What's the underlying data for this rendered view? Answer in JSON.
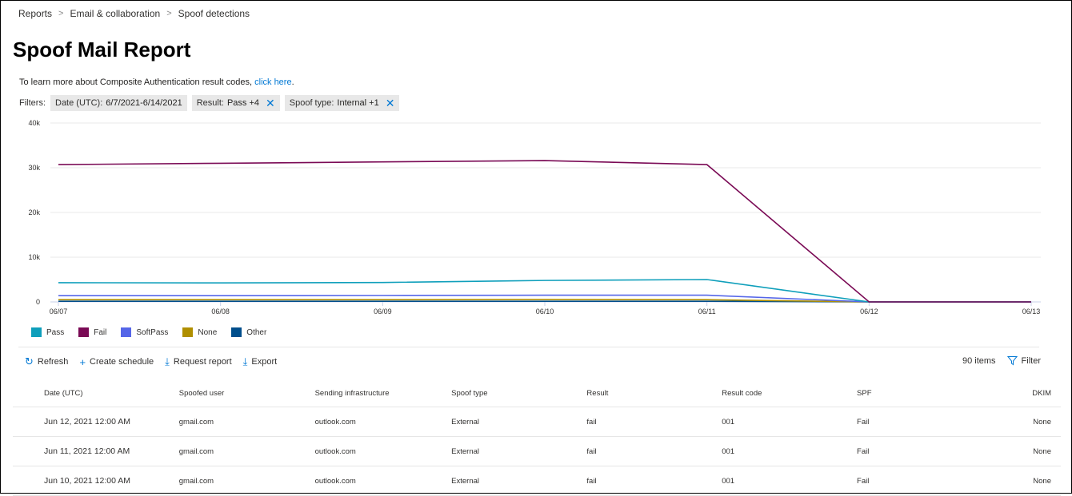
{
  "breadcrumb": [
    "Reports",
    "Email & collaboration",
    "Spoof detections"
  ],
  "title": "Spoof Mail Report",
  "learn": {
    "text": "To learn more about Composite Authentication result codes, ",
    "link": "click here",
    "suffix": "."
  },
  "filters": {
    "label": "Filters:",
    "chips": [
      {
        "key": "Date (UTC):",
        "value": "6/7/2021-6/14/2021",
        "removable": false
      },
      {
        "key": "Result:",
        "value": "Pass +4",
        "removable": true
      },
      {
        "key": "Spoof type:",
        "value": "Internal +1",
        "removable": true
      }
    ]
  },
  "chart_data": {
    "type": "line",
    "x": [
      "06/07",
      "06/08",
      "06/09",
      "06/10",
      "06/11",
      "06/12",
      "06/13"
    ],
    "yticks": [
      "0",
      "10k",
      "20k",
      "30k",
      "40k"
    ],
    "ylim": [
      0,
      40000
    ],
    "grid": true,
    "legend_position": "bottom-left",
    "series": [
      {
        "name": "Pass",
        "color": "#0f9fbb",
        "values": [
          4300,
          4250,
          4350,
          4800,
          5000,
          0,
          0
        ]
      },
      {
        "name": "Fail",
        "color": "#7a0a55",
        "values": [
          30700,
          31000,
          31300,
          31600,
          30700,
          0,
          0
        ]
      },
      {
        "name": "SoftPass",
        "color": "#5566e8",
        "values": [
          1400,
          1400,
          1450,
          1500,
          1500,
          0,
          0
        ]
      },
      {
        "name": "None",
        "color": "#b08f00",
        "values": [
          500,
          500,
          500,
          550,
          500,
          0,
          0
        ]
      },
      {
        "name": "Other",
        "color": "#004e8c",
        "values": [
          150,
          150,
          150,
          150,
          150,
          0,
          0
        ]
      }
    ]
  },
  "toolbar": {
    "refresh": "Refresh",
    "create_schedule": "Create schedule",
    "request_report": "Request report",
    "export": "Export",
    "item_count": "90 items",
    "filter": "Filter"
  },
  "table": {
    "columns": [
      "Date (UTC)",
      "Spoofed user",
      "Sending infrastructure",
      "Spoof type",
      "Result",
      "Result code",
      "SPF",
      "DKIM"
    ],
    "rows": [
      [
        "Jun 12, 2021 12:00 AM",
        "gmail.com",
        "outlook.com",
        "External",
        "fail",
        "001",
        "Fail",
        "None"
      ],
      [
        "Jun 11, 2021 12:00 AM",
        "gmail.com",
        "outlook.com",
        "External",
        "fail",
        "001",
        "Fail",
        "None"
      ],
      [
        "Jun 10, 2021 12:00 AM",
        "gmail.com",
        "outlook.com",
        "External",
        "fail",
        "001",
        "Fail",
        "None"
      ]
    ]
  }
}
